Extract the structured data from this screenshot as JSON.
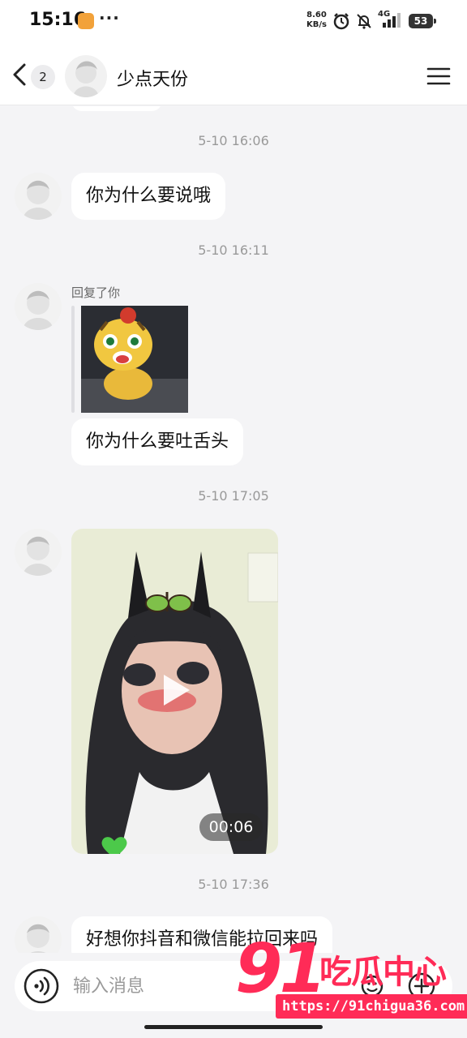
{
  "status_bar": {
    "time": "15:16",
    "more": "···",
    "net_speed_value": "8.60",
    "net_speed_unit": "KB/s",
    "network": "4G",
    "battery": "53",
    "icons": [
      "app-icon",
      "alarm-icon",
      "mute-icon",
      "signal-icon",
      "battery-icon"
    ]
  },
  "header": {
    "unread_count": "2",
    "contact_name": "少点天份"
  },
  "messages": {
    "ts1": "5-10 16:06",
    "msg1": "你为什么要说哦",
    "ts2": "5-10 16:11",
    "reply_label": "回复了你",
    "msg2": "你为什么要吐舌头",
    "ts3": "5-10 17:05",
    "video_duration": "00:06",
    "ts4": "5-10 17:36",
    "msg3": "好想你抖音和微信能拉回来吗"
  },
  "input": {
    "placeholder": "输入消息"
  },
  "watermark": {
    "number": "91",
    "text": "吃瓜中心",
    "url": "https://91chigua36.com"
  },
  "colors": {
    "background": "#f4f4f6",
    "bubble": "#ffffff",
    "timestamp": "#999999",
    "watermark": "#ff2b57"
  }
}
